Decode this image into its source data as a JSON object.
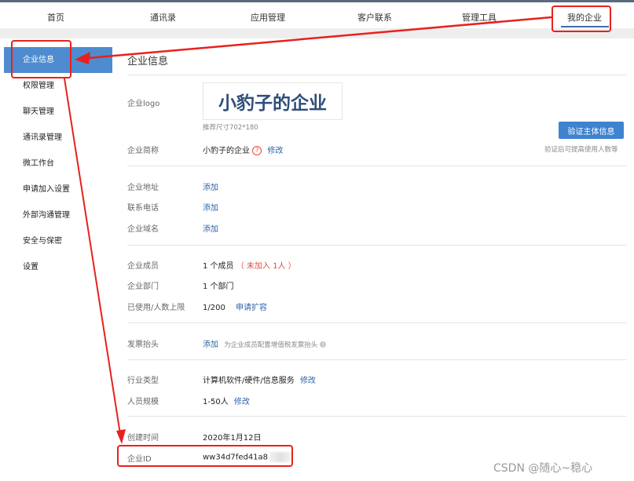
{
  "nav": {
    "items": [
      "首页",
      "通讯录",
      "应用管理",
      "客户联系",
      "管理工具",
      "我的企业"
    ]
  },
  "sidebar": {
    "items": [
      "企业信息",
      "权限管理",
      "聊天管理",
      "通讯录管理",
      "微工作台",
      "申请加入设置",
      "外部沟通管理",
      "安全与保密",
      "设置"
    ]
  },
  "main": {
    "title": "企业信息",
    "logo_label": "企业logo",
    "logo_text": "小豹子的企业",
    "logo_hint": "推荐尺寸702*180",
    "verify_button": "验证主体信息",
    "verify_hint": "验证后可提高使用人数等",
    "short_name_label": "企业简称",
    "short_name_value": "小豹子的企业",
    "short_name_help": "?",
    "edit_link": "修改",
    "address_label": "企业地址",
    "phone_label": "联系电话",
    "domain_label": "企业域名",
    "add_link": "添加",
    "members_label": "企业成员",
    "members_value": "1 个成员",
    "members_unjoined": "（ 未加入 1人 ）",
    "departments_label": "企业部门",
    "departments_value": "1 个部门",
    "limit_label": "已使用/人数上限",
    "limit_value": "1/200",
    "expand_link": "申请扩容",
    "invoice_label": "发票抬头",
    "invoice_hint": "为企业成员配置增值税发票抬头",
    "industry_label": "行业类型",
    "industry_value": "计算机软件/硬件/信息服务",
    "size_label": "人员规模",
    "size_value": "1-50人",
    "created_label": "创建时间",
    "created_value": "2020年1月12日",
    "corp_id_label": "企业ID",
    "corp_id_value": "ww34d7fed41a8"
  },
  "watermark": "CSDN @随心~稳心",
  "colors": {
    "accent": "#4e8ccf",
    "link": "#2f63a8",
    "annotation": "#e8211d"
  }
}
